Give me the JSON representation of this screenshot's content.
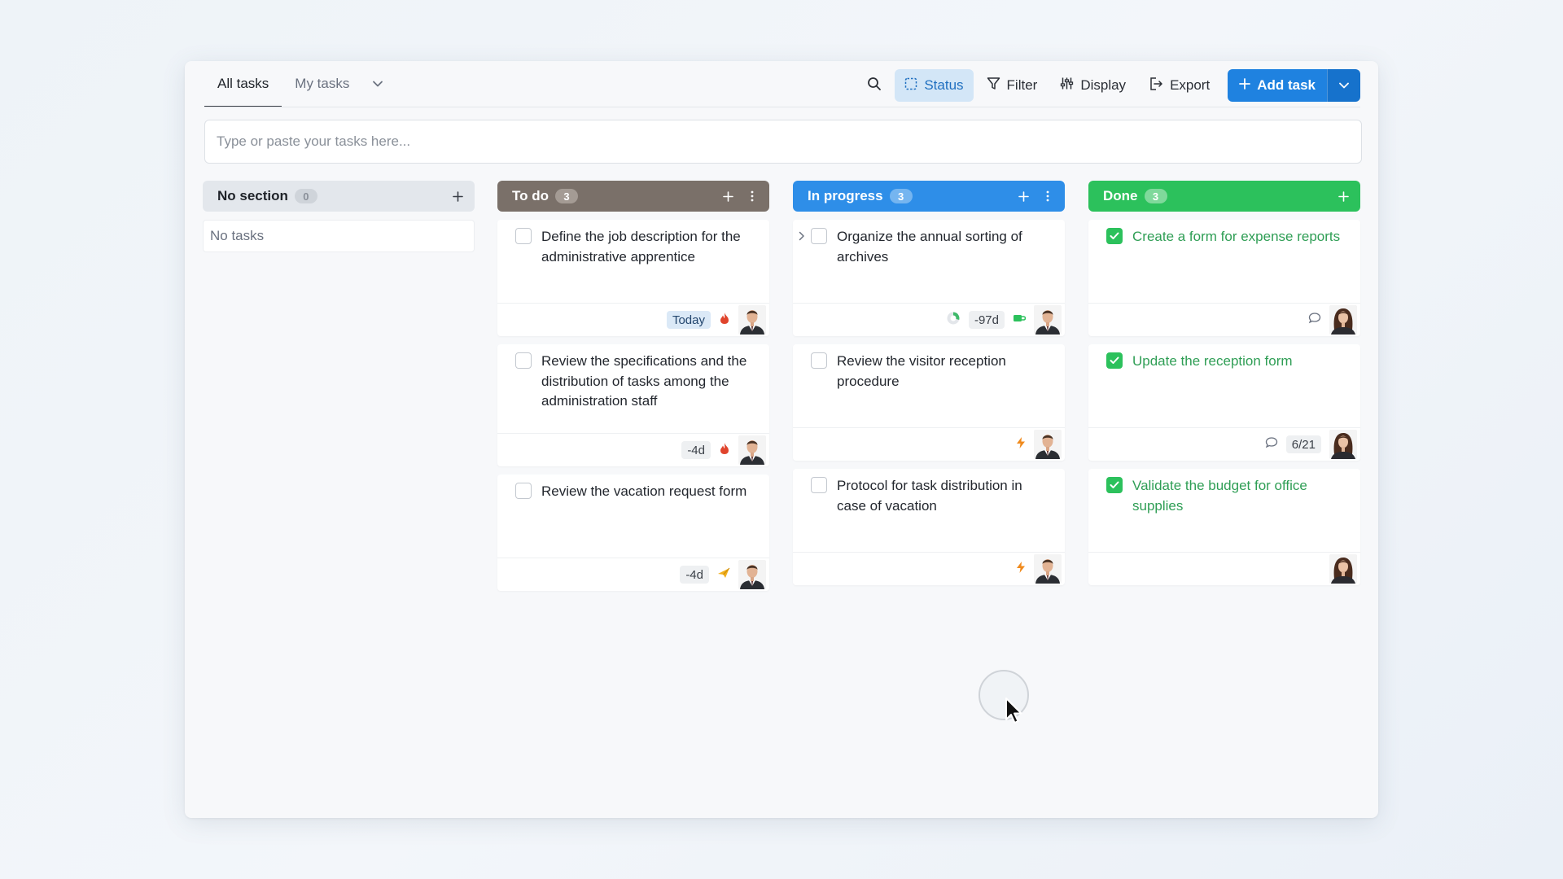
{
  "tabs": [
    {
      "label": "All tasks",
      "active": true
    },
    {
      "label": "My tasks",
      "active": false
    }
  ],
  "toolbar": {
    "status_label": "Status",
    "filter_label": "Filter",
    "display_label": "Display",
    "export_label": "Export",
    "add_task_label": "Add task"
  },
  "quick_add": {
    "placeholder": "Type or paste your tasks here..."
  },
  "colors": {
    "todo": "#7a7069",
    "in_progress": "#2e8ee8",
    "done": "#2cc15c",
    "primary": "#1f82e0"
  },
  "columns": {
    "no_section": {
      "title": "No section",
      "count": "0",
      "empty_text": "No tasks"
    },
    "todo": {
      "title": "To do",
      "count": "3",
      "cards": [
        {
          "text": "Define the job description for the administrative apprentice",
          "due": "Today",
          "priority_icon": "fire-icon"
        },
        {
          "text": "Review the specifications and the distribution of tasks among the administration staff",
          "due": "-4d",
          "priority_icon": "fire-icon"
        },
        {
          "text": "Review the vacation request form",
          "due": "-4d",
          "priority_icon": "paper-plane-icon"
        }
      ]
    },
    "in_progress": {
      "title": "In progress",
      "count": "3",
      "cards": [
        {
          "text": "Organize the annual sorting of archives",
          "due": "-97d",
          "priority_icon": "cup-icon"
        },
        {
          "text": "Review the visitor reception procedure",
          "priority_icon": "lightning-icon"
        },
        {
          "text": "Protocol for task distribution in case of vacation",
          "priority_icon": "lightning-icon"
        }
      ]
    },
    "done": {
      "title": "Done",
      "count": "3",
      "cards": [
        {
          "text": "Create a form for expense reports"
        },
        {
          "text": "Update the reception form",
          "subtasks": "6/21"
        },
        {
          "text": "Validate the budget for office supplies"
        }
      ]
    }
  }
}
